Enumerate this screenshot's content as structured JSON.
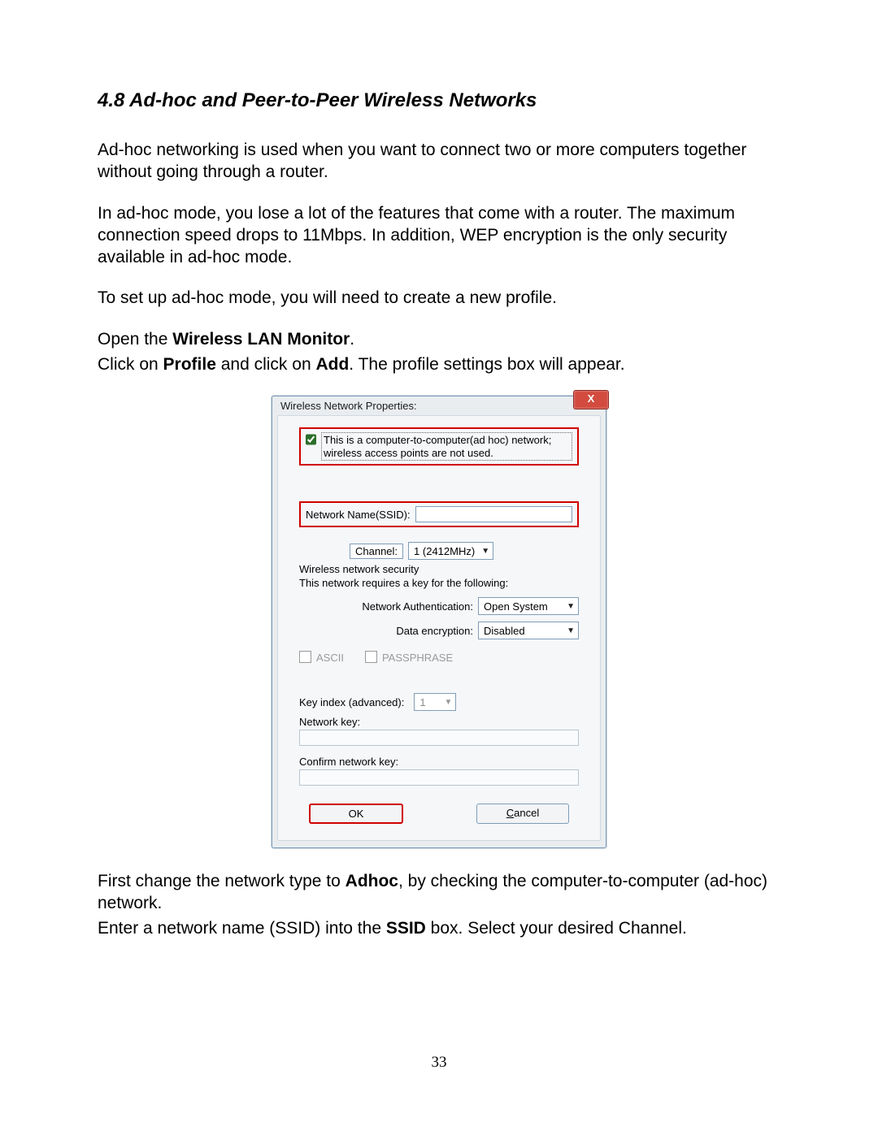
{
  "section_heading": "4.8 Ad-hoc and Peer-to-Peer Wireless Networks",
  "para1": "Ad-hoc networking is used when you want to connect two or more computers together without going through a router.",
  "para2": "In ad-hoc mode, you lose a lot of the features that come with a router. The maximum connection speed drops to 11Mbps. In addition, WEP encryption is the only security available in ad-hoc mode.",
  "para3": "To set up ad-hoc mode, you will need to create a new profile.",
  "open_line_pre": "Open the ",
  "open_line_bold": "Wireless LAN Monitor",
  "open_line_post": ".",
  "click_line_p1": "Click on ",
  "click_line_b1": "Profile",
  "click_line_p2": " and click on ",
  "click_line_b2": "Add",
  "click_line_p3": ". The profile settings box will appear.",
  "dialog": {
    "title": "Wireless Network Properties:",
    "close": "X",
    "adhoc_text": "This is a computer-to-computer(ad hoc) network; wireless access points are not used.",
    "ssid_label": "Network Name(SSID):",
    "channel_label": "Channel:",
    "channel_value": "1  (2412MHz)",
    "security_header": "Wireless network security",
    "security_sub": "This network requires a key for the following:",
    "auth_label": "Network Authentication:",
    "auth_value": "Open System",
    "enc_label": "Data encryption:",
    "enc_value": "Disabled",
    "opt_ascii": "ASCII",
    "opt_pass": "PASSPHRASE",
    "key_index_label": "Key index (advanced):",
    "key_index_value": "1",
    "net_key_label": "Network key:",
    "confirm_key_label": "Confirm network key:",
    "ok": "OK",
    "cancel_pre": "C",
    "cancel_rest": "ancel"
  },
  "after1_p1": "First change the network type to ",
  "after1_b1": "Adhoc",
  "after1_p2": ", by checking the computer-to-computer (ad-hoc) network.",
  "after2_p1": "Enter a network name (SSID) into the ",
  "after2_b1": "SSID",
  "after2_p2": " box. Select your desired Channel.",
  "page_number": "33"
}
